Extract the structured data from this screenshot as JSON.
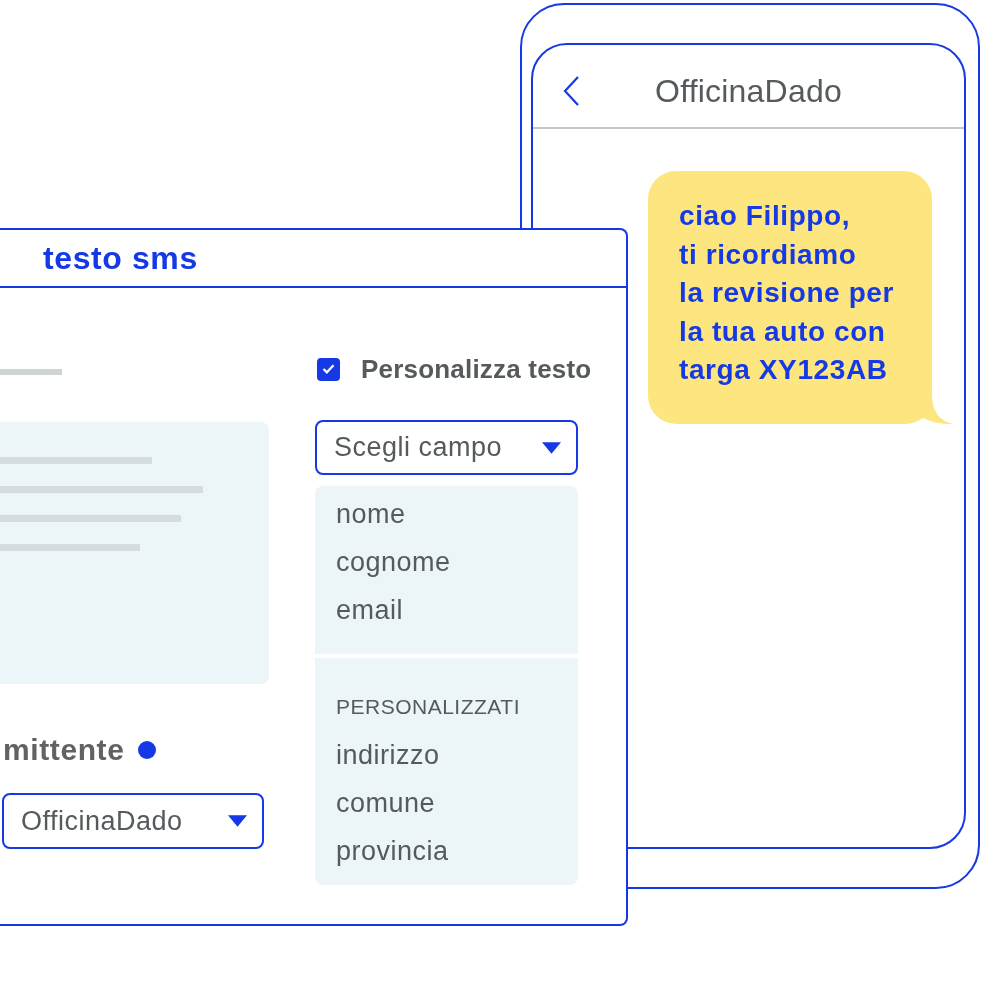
{
  "phone": {
    "title": "OfficinaDado",
    "messages": [
      {
        "text": "ciao Filippo,\nti ricordiamo\nla revisione per\nla tua auto con\ntarga XY123AB"
      }
    ]
  },
  "panel": {
    "title": "testo sms",
    "personalize": {
      "label": "Personalizza testo",
      "checked": true
    },
    "field_select": {
      "placeholder": "Scegli campo",
      "expanded": true,
      "groups": [
        {
          "items": [
            {
              "label": "nome",
              "selected": false
            },
            {
              "label": "cognome",
              "selected": false
            },
            {
              "label": "email",
              "selected": false
            }
          ]
        },
        {
          "header": "PERSONALIZZATI",
          "items": [
            {
              "label": "indirizzo",
              "selected": false
            },
            {
              "label": "comune",
              "selected": false
            },
            {
              "label": "provincia",
              "selected": false
            }
          ]
        }
      ]
    },
    "sender": {
      "label": "mittente",
      "value": "OfficinaDado"
    }
  }
}
